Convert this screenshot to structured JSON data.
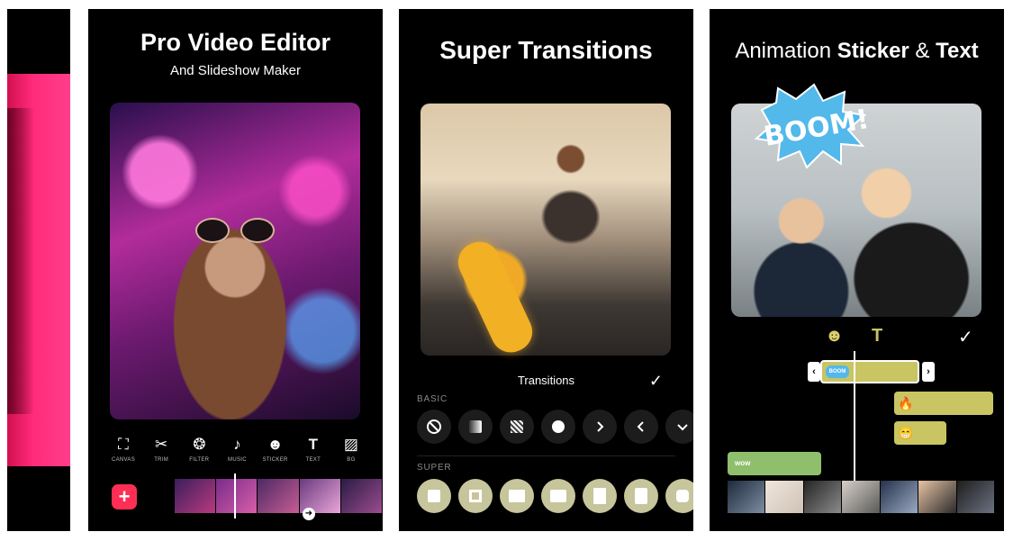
{
  "panel2": {
    "title": "Pro Video Editor",
    "subtitle": "And Slideshow Maker",
    "tools": [
      {
        "icon": "crop-icon",
        "glyph": "⛶",
        "label": "CANVAS"
      },
      {
        "icon": "scissors-icon",
        "glyph": "✂",
        "label": "TRIM"
      },
      {
        "icon": "filter-icon",
        "glyph": "❂",
        "label": "FILTER"
      },
      {
        "icon": "music-note-icon",
        "glyph": "♪",
        "label": "MUSIC"
      },
      {
        "icon": "smiley-icon",
        "glyph": "☻",
        "label": "STICKER"
      },
      {
        "icon": "text-icon",
        "glyph": "T",
        "label": "TEXT"
      },
      {
        "icon": "bg-icon",
        "glyph": "▨",
        "label": "BG"
      }
    ],
    "add_label": "+"
  },
  "panel3": {
    "title": "Super Transitions",
    "header": "Transitions",
    "check": "✓",
    "basic_label": "BASIC",
    "super_label": "SUPER"
  },
  "panel4": {
    "title_prefix": "Animation ",
    "title_bold1": "Sticker",
    "title_mid": " & ",
    "title_bold2": "Text",
    "sticker_text": "BOOM!",
    "mini_sticker": "BOOM",
    "smiley": "☻",
    "text_tool": "T",
    "check": "✓",
    "left_handle": "‹",
    "right_handle": "›",
    "fire_emoji": "🔥",
    "grin_emoji": "😁",
    "wow_label": "wow"
  },
  "colors": {
    "accent_red": "#ff2e55",
    "sticker_clip": "#c9c563",
    "wow_clip": "#8fbf6d",
    "boom_blue": "#53b8ea"
  }
}
